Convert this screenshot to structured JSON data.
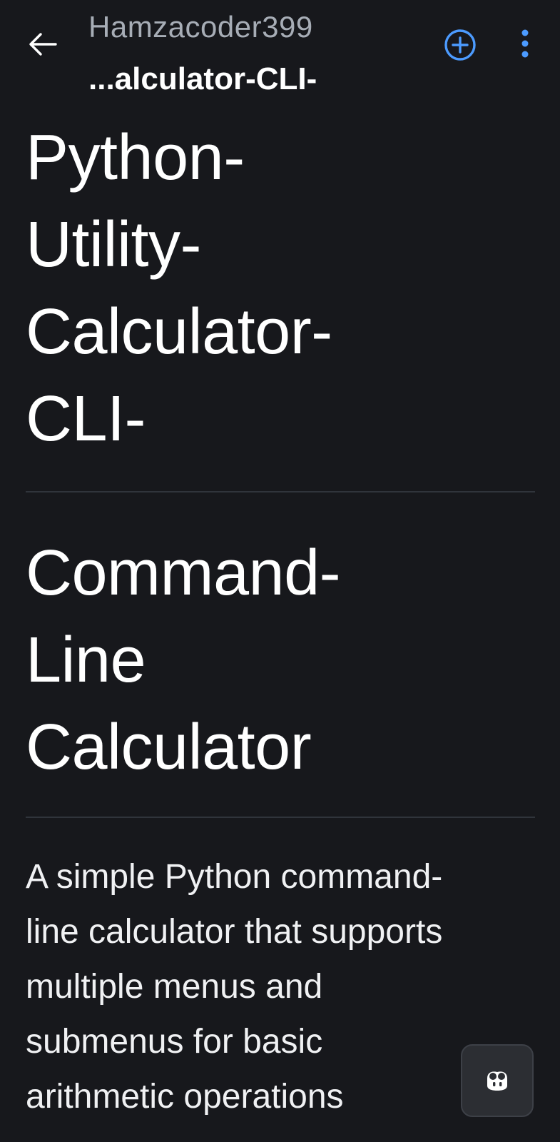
{
  "header": {
    "owner": "Hamzacoder399",
    "repo_name": "...alculator-CLI-",
    "back_icon": "arrow-left-icon",
    "add_icon": "plus-circle-icon",
    "more_icon": "kebab-menu-icon"
  },
  "readme": {
    "title_lines": [
      "Python-",
      "Utility-",
      "Calculator-",
      "CLI-"
    ],
    "subtitle_lines": [
      "Command-",
      "Line",
      "Calculator"
    ],
    "description_lines": [
      "A simple Python command-",
      "line calculator that supports",
      "multiple menus and",
      "submenus for basic",
      "arithmetic operations"
    ]
  },
  "fab": {
    "icon": "copilot-icon"
  },
  "colors": {
    "background": "#17181c",
    "accent": "#4c9bff",
    "owner_text": "#a7adb6",
    "divider": "#30343b"
  }
}
